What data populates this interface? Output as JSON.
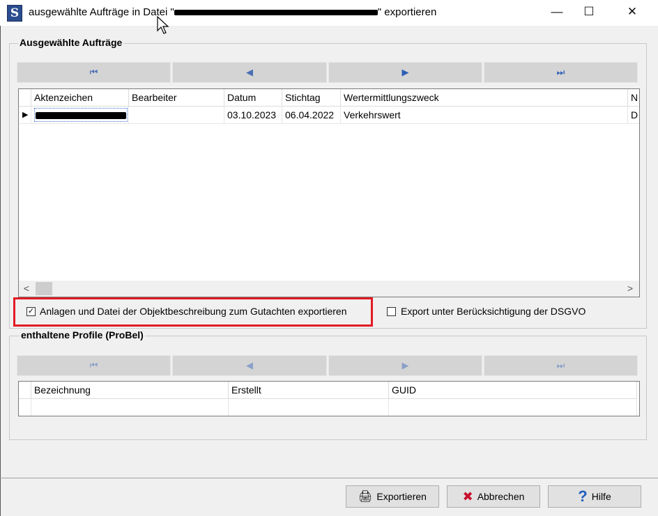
{
  "window": {
    "title_prefix": "ausgewählte Aufträge in Datei \"",
    "title_suffix": "\" exportieren",
    "minimize_glyph": "—",
    "maximize_glyph": "☐",
    "close_glyph": "✕",
    "app_icon_letter": "S"
  },
  "orders_group": {
    "title": "Ausgewählte Aufträge",
    "nav": {
      "first": "⏮",
      "prev": "◀",
      "next": "▶",
      "last": "⏭"
    },
    "columns": [
      "Aktenzeichen",
      "Bearbeiter",
      "Datum",
      "Stichtag",
      "Wertermittlungszweck",
      "N"
    ],
    "rows": [
      {
        "aktenzeichen": "",
        "bearbeiter": "",
        "datum": "03.10.2023",
        "stichtag": "06.04.2022",
        "zweck": "Verkehrswert",
        "n": "D"
      }
    ],
    "row_indicator": "▶",
    "scroll_left": "<",
    "scroll_right": ">"
  },
  "options": {
    "attachments_label": "Anlagen und Datei der Objektbeschreibung zum Gutachten exportieren",
    "attachments_checked": true,
    "dsgvo_label": "Export unter Berücksichtigung der DSGVO",
    "dsgvo_checked": false,
    "check_glyph": "✓"
  },
  "profiles_group": {
    "title": "enthaltene Profile (ProBel)",
    "nav": {
      "first": "⏮",
      "prev": "◀",
      "next": "▶",
      "last": "⏭"
    },
    "columns": [
      "Bezeichnung",
      "Erstellt",
      "GUID"
    ]
  },
  "buttons": {
    "export_label": "Exportieren",
    "cancel_label": "Abbrechen",
    "help_label": "Hilfe",
    "export_icon": "🖨",
    "cancel_icon": "✖",
    "help_icon": "?"
  },
  "colors": {
    "highlight_border": "#e21b24",
    "cancel_icon": "#c8102e",
    "help_icon": "#1f5fbf"
  }
}
